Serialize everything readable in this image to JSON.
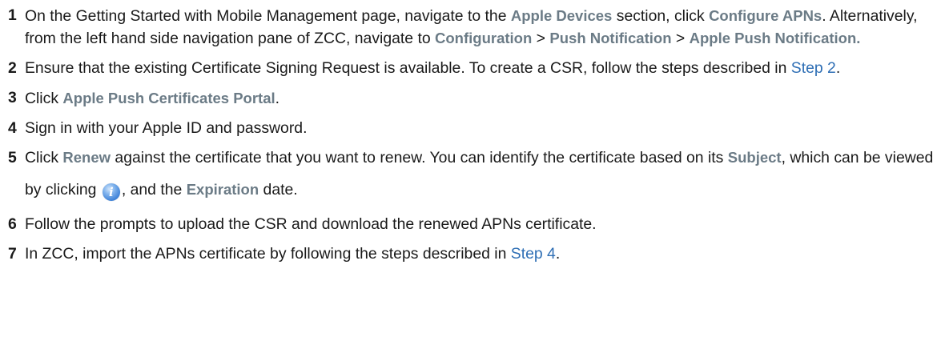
{
  "steps": [
    {
      "num": "1",
      "t1": "On the Getting Started with Mobile Management page, navigate to the ",
      "ui1": "Apple Devices",
      "t2": " section, click ",
      "ui2": "Configure APNs",
      "t3": ". Alternatively, from the left hand side navigation pane of ZCC, navigate to ",
      "ui3": "Configuration",
      "t4": " > ",
      "ui4": "Push Notification",
      "t5": " > ",
      "ui5": "Apple Push Notification."
    },
    {
      "num": "2",
      "t1": "Ensure that the existing Certificate Signing Request is available. To create a CSR, follow the steps described in ",
      "link": "Step 2",
      "t2": "."
    },
    {
      "num": "3",
      "t1": "Click ",
      "ui1": "Apple Push Certificates Portal",
      "t2": "."
    },
    {
      "num": "4",
      "t1": "Sign in with your Apple ID and password."
    },
    {
      "num": "5",
      "t1": "Click ",
      "ui1": "Renew",
      "t2": " against the certificate that you want to renew. You can identify the certificate based on its ",
      "ui2": "Subject",
      "t3": ", which can be viewed by clicking ",
      "icon": "info-icon",
      "t4": ", and the ",
      "ui3": "Expiration",
      "t5": " date."
    },
    {
      "num": "6",
      "t1": "Follow the prompts to upload the CSR and download the renewed APNs certificate."
    },
    {
      "num": "7",
      "t1": "In ZCC, import the APNs certificate by following the steps described in ",
      "link": "Step 4",
      "t2": "."
    }
  ]
}
